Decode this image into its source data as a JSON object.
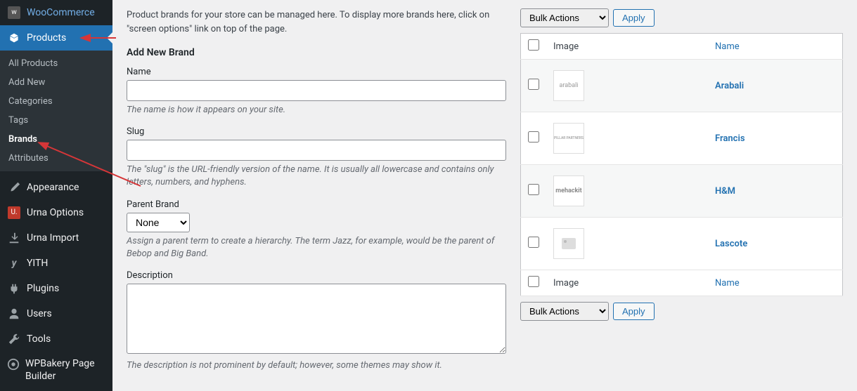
{
  "sidebar": {
    "woocommerce": "WooCommerce",
    "products": "Products",
    "submenu": [
      "All Products",
      "Add New",
      "Categories",
      "Tags",
      "Brands",
      "Attributes"
    ],
    "appearance": "Appearance",
    "urna_options": "Urna Options",
    "urna_import": "Urna Import",
    "yith": "YITH",
    "plugins": "Plugins",
    "users": "Users",
    "tools": "Tools",
    "wpbakery": "WPBakery Page Builder"
  },
  "main": {
    "intro": "Product brands for your store can be managed here. To display more brands here, click on \"screen options\" link on top of the page.",
    "heading": "Add New Brand",
    "fields": {
      "name": {
        "label": "Name",
        "help": "The name is how it appears on your site."
      },
      "slug": {
        "label": "Slug",
        "help": "The \"slug\" is the URL-friendly version of the name. It is usually all lowercase and contains only letters, numbers, and hyphens."
      },
      "parent": {
        "label": "Parent Brand",
        "selected": "None",
        "help": "Assign a parent term to create a hierarchy. The term Jazz, for example, would be the parent of Bebop and Big Band."
      },
      "description": {
        "label": "Description",
        "help": "The description is not prominent by default; however, some themes may show it."
      }
    }
  },
  "table": {
    "bulk_label": "Bulk Actions",
    "apply": "Apply",
    "columns": {
      "image": "Image",
      "name": "Name"
    },
    "rows": [
      {
        "thumb_text": "arabali",
        "name": "Arabali"
      },
      {
        "thumb_text": "PILLAR PARTNERS",
        "name": "Francis"
      },
      {
        "thumb_text": "mehackit",
        "name": "H&M"
      },
      {
        "thumb_text": "",
        "name": "Lascote"
      }
    ]
  }
}
